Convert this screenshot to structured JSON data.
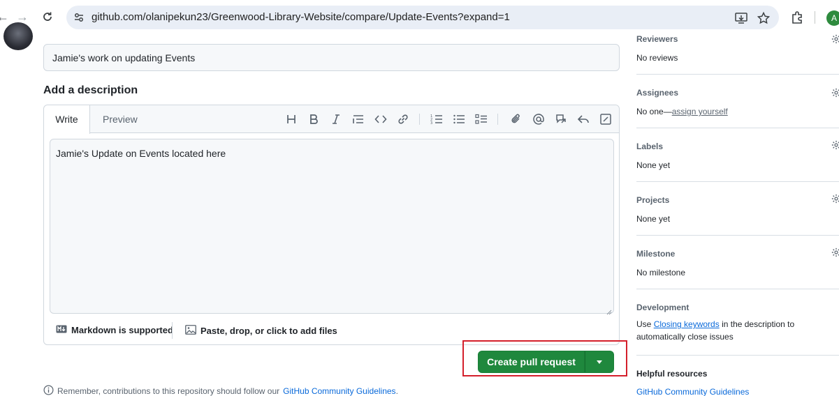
{
  "browser": {
    "url": "github.com/olanipekun23/Greenwood-Library-Website/compare/Update-Events?expand=1",
    "profile_initial": "A"
  },
  "form": {
    "title_value": "Jamie's work on updating Events",
    "description_heading": "Add a description",
    "tab_write": "Write",
    "tab_preview": "Preview",
    "body_value": "Jamie's Update on Events located here",
    "markdown_note": "Markdown is supported",
    "files_note": "Paste, drop, or click to add files"
  },
  "actions": {
    "create_pr": "Create pull request"
  },
  "footer": {
    "remember_text": "Remember, contributions to this repository should follow our",
    "guidelines_link": "GitHub Community Guidelines",
    "period": "."
  },
  "sidebar": {
    "reviewers": {
      "title": "Reviewers",
      "value": "No reviews"
    },
    "assignees": {
      "title": "Assignees",
      "value_prefix": "No one—",
      "value_link": "assign yourself"
    },
    "labels": {
      "title": "Labels",
      "value": "None yet"
    },
    "projects": {
      "title": "Projects",
      "value": "None yet"
    },
    "milestone": {
      "title": "Milestone",
      "value": "No milestone"
    },
    "development": {
      "title": "Development",
      "text_before": "Use ",
      "link": "Closing keywords",
      "text_after": " in the description to automatically close issues"
    },
    "helpful": {
      "title": "Helpful resources",
      "link": "GitHub Community Guidelines"
    }
  },
  "colors": {
    "primary_button": "#1f883d",
    "link": "#0969da",
    "highlight_border": "#d41f2b"
  }
}
